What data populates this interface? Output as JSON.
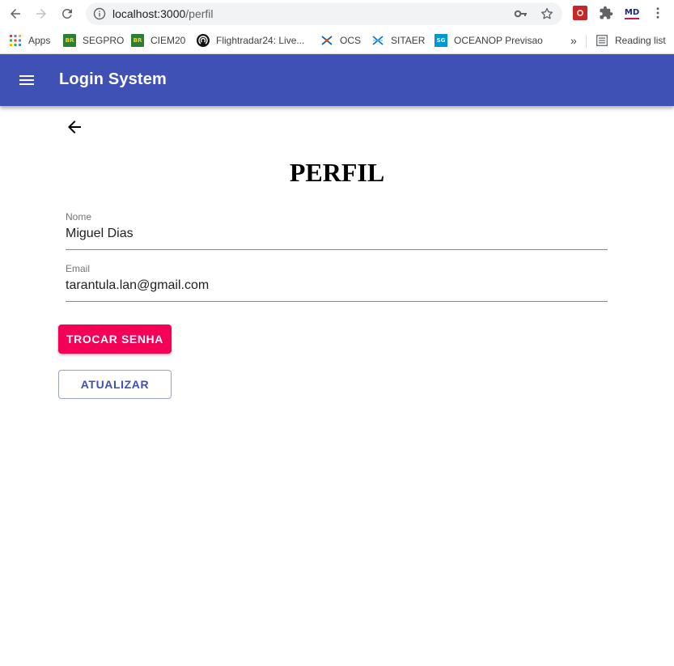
{
  "browser": {
    "url_host": "localhost:3000",
    "url_path": "/perfil",
    "bookmarks": [
      {
        "label": "Apps",
        "icon": "apps-grid-icon"
      },
      {
        "label": "SEGPRO",
        "icon": "br-flag-icon",
        "badge": "BR"
      },
      {
        "label": "CIEM20",
        "icon": "br-flag-icon",
        "badge": "BR"
      },
      {
        "label": "Flightradar24: Live...",
        "icon": "flightradar-icon"
      },
      {
        "label": "OCS",
        "icon": "ocs-icon"
      },
      {
        "label": "SITAER",
        "icon": "sitaer-icon"
      },
      {
        "label": "OCEANOP Previsao",
        "icon": "sg-icon",
        "badge": "SG"
      }
    ],
    "overflow_label": "»",
    "reading_list_label": "Reading list",
    "ext_md_label": "MD"
  },
  "appbar": {
    "title": "Login System",
    "color": "#3f51b5"
  },
  "page": {
    "title": "PERFIL",
    "fields": [
      {
        "label": "Nome",
        "value": "Miguel Dias"
      },
      {
        "label": "Email",
        "value": "tarantula.lan@gmail.com"
      }
    ],
    "change_password_label": "TROCAR SENHA",
    "update_label": "ATUALIZAR",
    "accent_color": "#f50057"
  }
}
